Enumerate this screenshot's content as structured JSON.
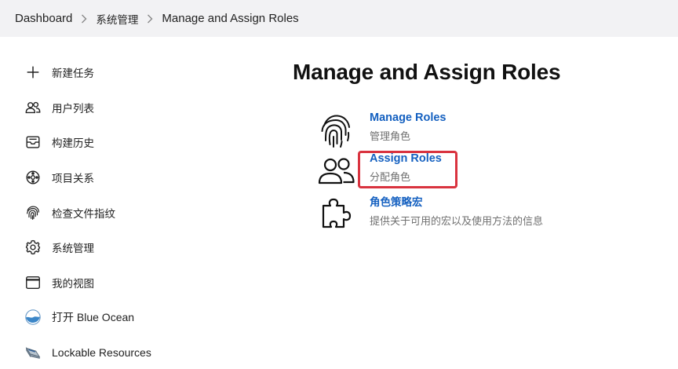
{
  "breadcrumb": {
    "items": [
      "Dashboard",
      "系统管理",
      "Manage and Assign Roles"
    ]
  },
  "sidebar": {
    "items": [
      {
        "label": "新建任务",
        "icon": "plus-icon"
      },
      {
        "label": "用户列表",
        "icon": "people-icon"
      },
      {
        "label": "构建历史",
        "icon": "inbox-icon"
      },
      {
        "label": "项目关系",
        "icon": "relationship-icon"
      },
      {
        "label": "检查文件指纹",
        "icon": "fingerprint-icon"
      },
      {
        "label": "系统管理",
        "icon": "gear-icon"
      },
      {
        "label": "我的视图",
        "icon": "window-icon"
      },
      {
        "label": "打开 Blue Ocean",
        "icon": "blue-ocean-icon"
      },
      {
        "label": "Lockable Resources",
        "icon": "lockable-resources-icon"
      }
    ]
  },
  "main": {
    "title": "Manage and Assign Roles",
    "items": [
      {
        "link": "Manage Roles",
        "desc": "管理角色",
        "icon": "fingerprint-icon"
      },
      {
        "link": "Assign Roles",
        "desc": "分配角色",
        "icon": "people-icon"
      },
      {
        "link": "角色策略宏",
        "desc": "提供关于可用的宏以及使用方法的信息",
        "icon": "puzzle-icon"
      }
    ]
  },
  "colors": {
    "breadcrumb_bg": "#f2f2f4",
    "link": "#1460c0",
    "highlight": "#d9333f",
    "muted_text": "#707070"
  }
}
